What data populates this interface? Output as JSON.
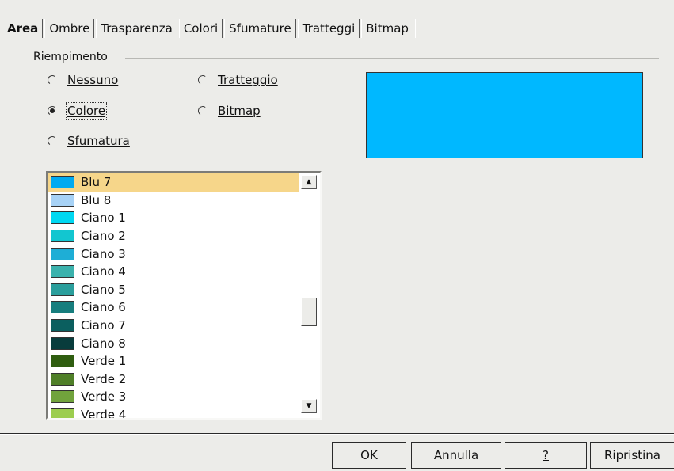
{
  "tabs": [
    "Area",
    "Ombre",
    "Trasparenza",
    "Colori",
    "Sfumature",
    "Tratteggi",
    "Bitmap"
  ],
  "fill": {
    "group_label": "Riempimento",
    "options": {
      "none": "Nessuno",
      "color": "Colore",
      "gradient": "Sfumatura",
      "hatching": "Tratteggio",
      "bitmap": "Bitmap"
    },
    "selected": "Colore",
    "preview_color": "#00b8ff"
  },
  "color_list": [
    {
      "name": "Blu 7",
      "color": "#00aaf0",
      "selected": true
    },
    {
      "name": "Blu 8",
      "color": "#a7d2f6"
    },
    {
      "name": "Ciano 1",
      "color": "#00d8f2"
    },
    {
      "name": "Ciano 2",
      "color": "#12c6d0"
    },
    {
      "name": "Ciano 3",
      "color": "#1eaed6"
    },
    {
      "name": "Ciano 4",
      "color": "#3bb2ad"
    },
    {
      "name": "Ciano 5",
      "color": "#2a9e9c"
    },
    {
      "name": "Ciano 6",
      "color": "#177e7e"
    },
    {
      "name": "Ciano 7",
      "color": "#0b5f5f"
    },
    {
      "name": "Ciano 8",
      "color": "#083c3c"
    },
    {
      "name": "Verde 1",
      "color": "#2f5d10"
    },
    {
      "name": "Verde 2",
      "color": "#4f7f28"
    },
    {
      "name": "Verde 3",
      "color": "#71a33c"
    },
    {
      "name": "Verde 4",
      "color": "#9ccd4e"
    }
  ],
  "buttons": {
    "ok": "OK",
    "cancel": "Annulla",
    "help": "?",
    "reset": "Ripristina"
  }
}
